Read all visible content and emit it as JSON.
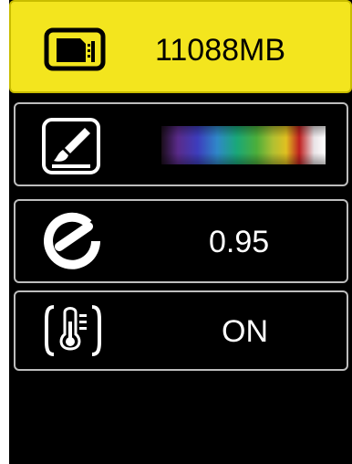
{
  "menu": {
    "items": [
      {
        "icon": "sd-card-icon",
        "value": "11088MB",
        "selected": true
      },
      {
        "icon": "palette-brush-icon",
        "value": "",
        "selected": false
      },
      {
        "icon": "emissivity-icon",
        "value": "0.95",
        "selected": false
      },
      {
        "icon": "thermometer-icon",
        "value": "ON",
        "selected": false
      }
    ]
  },
  "colors": {
    "screen_background": "#000000",
    "highlight": "#f3e51e",
    "border": "#bdbdbd",
    "text": "#ffffff",
    "palette_stops": [
      "#1a0d1a",
      "#5a2b8a",
      "#3d3dbd",
      "#2f88c8",
      "#1aa878",
      "#4cae3a",
      "#b0c032",
      "#e0c020",
      "#c02020",
      "#e9e3e6",
      "#ffffff"
    ]
  }
}
